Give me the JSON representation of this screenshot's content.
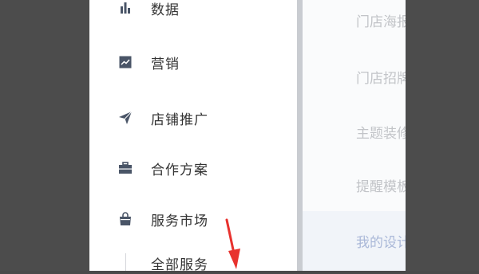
{
  "nav": {
    "items": [
      {
        "label": "数据",
        "icon": "bar-chart-icon"
      },
      {
        "label": "营销",
        "icon": "trend-chart-icon"
      },
      {
        "label": "店铺推广",
        "icon": "paper-plane-icon"
      },
      {
        "label": "合作方案",
        "icon": "briefcase-icon"
      },
      {
        "label": "服务市场",
        "icon": "shopping-bag-icon"
      }
    ],
    "sub_items": [
      {
        "label": "全部服务"
      }
    ]
  },
  "right_panel": {
    "items": [
      {
        "label": "门店海报"
      },
      {
        "label": "门店招牌"
      },
      {
        "label": "主题装修"
      },
      {
        "label": "提醒模板"
      },
      {
        "label": "我的设计"
      }
    ]
  },
  "colors": {
    "overlay": "#4c4c4c",
    "panel": "#ffffff",
    "divider": "#c9ccd1",
    "text": "#333333",
    "muted_text": "#c2c4c8",
    "annotation_arrow": "#e8322e"
  },
  "annotation": {
    "icon": "red-arrow-icon"
  }
}
